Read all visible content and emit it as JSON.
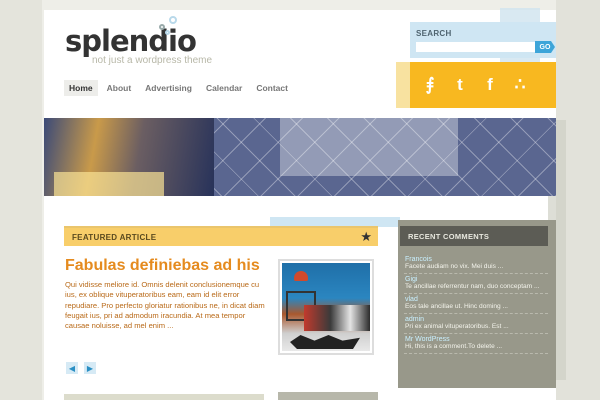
{
  "site": {
    "name": "splendio",
    "tagline": "not just a wordpress theme"
  },
  "nav": {
    "items": [
      "Home",
      "About",
      "Advertising",
      "Calendar",
      "Contact"
    ],
    "active": "Home"
  },
  "search": {
    "label": "SEARCH",
    "placeholder": "",
    "button_label": "GO"
  },
  "social": {
    "icons": [
      "rss-icon",
      "twitter-icon",
      "facebook-icon",
      "share-icon"
    ]
  },
  "featured": {
    "section_label": "FEATURED ARTICLE",
    "title": "Fabulas definiebas ad his",
    "body": "Qui vidisse meliore id. Omnis delenit conclusionemque cu ius, ex oblique vituperatoribus eam, eam id elit error repudiare. Pro perfecto gloriatur rationibus ne, in dicat diam feugait ius, pri ad admodum iracundia. At mea tempor causae noluisse, ad mel enim ...",
    "prev_label": "◀",
    "next_label": "▶"
  },
  "recent_comments": {
    "title": "RECENT COMMENTS",
    "items": [
      {
        "author": "Francois",
        "text": "Facete audiam no vix. Mei duis ..."
      },
      {
        "author": "Gigi",
        "text": "Te ancillae referrentur nam, duo conceptam ..."
      },
      {
        "author": "vlad",
        "text": "Eos tale ancillae ut. Hinc doming ..."
      },
      {
        "author": "admin",
        "text": "Pri ex animal vituperatoribus. Est ..."
      },
      {
        "author": "Mr WordPress",
        "text": "Hi, this is a comment.To delete ..."
      }
    ]
  },
  "colors": {
    "accent_orange": "#e58b1f",
    "accent_yellow": "#f8b820",
    "accent_blue": "#3da5d9",
    "sidebar_gray": "#98988a"
  }
}
